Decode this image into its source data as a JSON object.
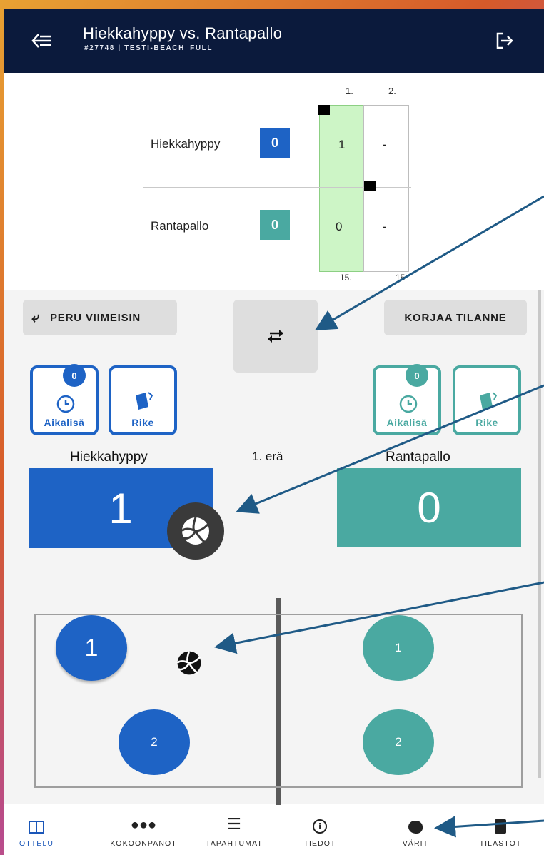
{
  "colors": {
    "home": "#1e63c5",
    "away": "#4aa9a1",
    "header": "#0b1a3c",
    "set_highlight": "#cdf5c6"
  },
  "header": {
    "title": "Hiekkahyppy vs. Rantapallo",
    "subtitle": "#27748 | TESTI-BEACH_FULL",
    "back_icon": "back-arrow-icon",
    "exit_icon": "exit-icon"
  },
  "scoretable": {
    "set_headers": [
      "1.",
      "2."
    ],
    "rows": [
      {
        "team": "Hiekkahyppy",
        "sets_won": "0",
        "set_scores": [
          "1",
          "-"
        ]
      },
      {
        "team": "Rantapallo",
        "sets_won": "0",
        "set_scores": [
          "0",
          "-"
        ]
      }
    ],
    "set_targets": [
      "15.",
      "15"
    ]
  },
  "controls": {
    "undo_label": "PERU VIIMEISIN",
    "fix_label": "KORJAA TILANNE",
    "swap_icon": "swap-arrows-icon"
  },
  "home": {
    "name": "Hiekkahyppy",
    "score": "1",
    "timeouts": "0",
    "timeout_label": "Aikalisä",
    "card_label": "Rike"
  },
  "away": {
    "name": "Rantapallo",
    "score": "0",
    "timeouts": "0",
    "timeout_label": "Aikalisä",
    "card_label": "Rike"
  },
  "set_label": "1. erä",
  "court": {
    "home_players": [
      "1",
      "2"
    ],
    "away_players": [
      "1",
      "2"
    ]
  },
  "nav": [
    {
      "label": "OTTELU",
      "icon": "scoreboard-icon",
      "active": true
    },
    {
      "label": "KOKOONPANOT",
      "icon": "team-icon",
      "active": false
    },
    {
      "label": "TAPAHTUMAT",
      "icon": "event-list-icon",
      "active": false
    },
    {
      "label": "TIEDOT",
      "icon": "info-icon",
      "active": false
    },
    {
      "label": "VÄRIT",
      "icon": "palette-icon",
      "active": false
    },
    {
      "label": "TILASTOT",
      "icon": "stats-doc-icon",
      "active": false
    }
  ]
}
